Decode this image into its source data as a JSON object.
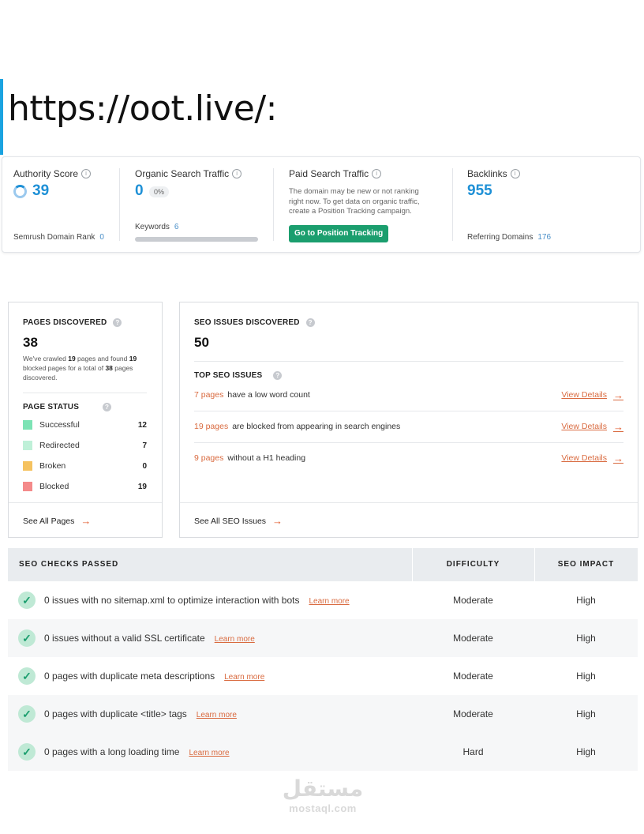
{
  "page_title": "https://oot.live/:",
  "metrics": {
    "authority": {
      "label": "Authority Score",
      "value": "39",
      "sub_label": "Semrush Domain Rank",
      "sub_value": "0"
    },
    "organic": {
      "label": "Organic Search Traffic",
      "value": "0",
      "pill": "0%",
      "sub_label": "Keywords",
      "sub_value": "6"
    },
    "paid": {
      "label": "Paid Search Traffic",
      "note": "The domain may be new or not ranking right now. To get data on organic traffic, create a Position Tracking campaign.",
      "button": "Go to Position Tracking"
    },
    "backlinks": {
      "label": "Backlinks",
      "value": "955",
      "sub_label": "Referring Domains",
      "sub_value": "176"
    }
  },
  "pages": {
    "title": "PAGES DISCOVERED",
    "value": "38",
    "desc_1": "We've crawled ",
    "desc_crawled": "19",
    "desc_2": " pages and found ",
    "desc_blocked": "19",
    "desc_3": " blocked pages for a total of ",
    "desc_total": "38",
    "desc_4": " pages discovered.",
    "status_title": "PAGE STATUS",
    "status": [
      {
        "label": "Successful",
        "count": "12",
        "color": "#7de3b5"
      },
      {
        "label": "Redirected",
        "count": "7",
        "color": "#bff0d8"
      },
      {
        "label": "Broken",
        "count": "0",
        "color": "#f5c260"
      },
      {
        "label": "Blocked",
        "count": "19",
        "color": "#f48a8a"
      }
    ],
    "see_all": "See All Pages"
  },
  "issues": {
    "title": "SEO ISSUES DISCOVERED",
    "value": "50",
    "top_title": "TOP SEO ISSUES",
    "items": [
      {
        "count": "7 pages",
        "text": "have a low word count",
        "link": "View Details"
      },
      {
        "count": "19 pages",
        "text": "are blocked from appearing in search engines",
        "link": "View Details"
      },
      {
        "count": "9 pages",
        "text": "without a H1 heading",
        "link": "View Details"
      }
    ],
    "see_all": "See All SEO Issues"
  },
  "checks": {
    "headers": [
      "SEO CHECKS PASSED",
      "DIFFICULTY",
      "SEO IMPACT"
    ],
    "rows": [
      {
        "text": "0 issues with no sitemap.xml to optimize interaction with bots",
        "learn": "Learn more",
        "difficulty": "Moderate",
        "impact": "High"
      },
      {
        "text": "0 issues without a valid SSL certificate",
        "learn": "Learn more",
        "difficulty": "Moderate",
        "impact": "High"
      },
      {
        "text": "0 pages with duplicate meta descriptions",
        "learn": "Learn more",
        "difficulty": "Moderate",
        "impact": "High"
      },
      {
        "text": "0 pages with duplicate <title> tags",
        "learn": "Learn more",
        "difficulty": "Moderate",
        "impact": "High"
      },
      {
        "text": "0 pages with a long loading time",
        "learn": "Learn more",
        "difficulty": "Hard",
        "impact": "High"
      }
    ]
  },
  "watermark": {
    "arabic": "مستقل",
    "latin": "mostaql.com"
  }
}
